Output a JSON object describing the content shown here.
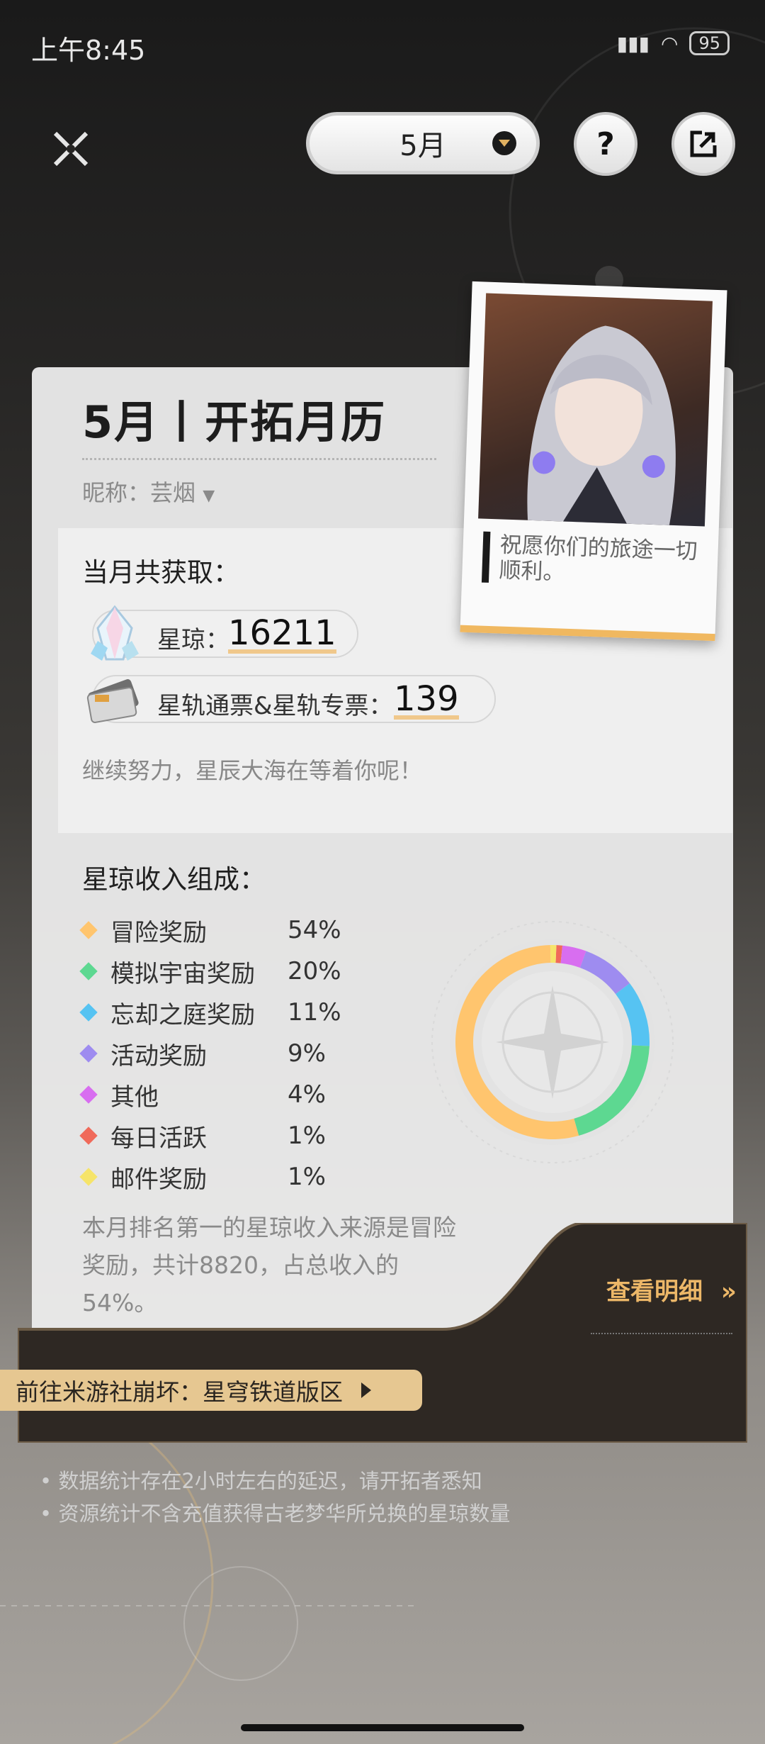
{
  "status_bar": {
    "time": "上午8:45",
    "battery": "95"
  },
  "header": {
    "month": "5月",
    "help_label": "?"
  },
  "card": {
    "title": "5月丨开拓月历",
    "nickname": "昵称：芸烟",
    "wish": "祝愿你们的旅途一切顺利。",
    "obtained_title": "当月共获取：",
    "stellar_jade_label": "星琼：",
    "stellar_jade_value": "16211",
    "pass_label": "星轨通票&星轨专票：",
    "pass_value": "139",
    "encourage": "继续努力，星辰大海在等着你呢！",
    "composition_title": "星琼收入组成：",
    "summary": "本月排名第一的星琼收入来源是冒险奖励，共计8820，占总收入的54%。"
  },
  "chart_data": {
    "type": "pie",
    "categories": [
      "冒险奖励",
      "模拟宇宙奖励",
      "忘却之庭奖励",
      "活动奖励",
      "其他",
      "每日活跃",
      "邮件奖励"
    ],
    "values": [
      54,
      20,
      11,
      9,
      4,
      1,
      1
    ],
    "labels": [
      "54%",
      "20%",
      "11%",
      "9%",
      "4%",
      "1%",
      "1%"
    ],
    "colors": [
      "#ffc56e",
      "#5dd891",
      "#56c3f2",
      "#9e8cf0",
      "#d86ef0",
      "#f06a5a",
      "#f6e46a"
    ]
  },
  "bottom": {
    "detail_label": "查看明细",
    "detail_arrow": "»",
    "forum_label": "前往米游社崩坏：星穹铁道版区",
    "notes": [
      "数据统计存在2小时左右的延迟，请开拓者悉知",
      "资源统计不含充值获得古老梦华所兑换的星琼数量"
    ]
  }
}
